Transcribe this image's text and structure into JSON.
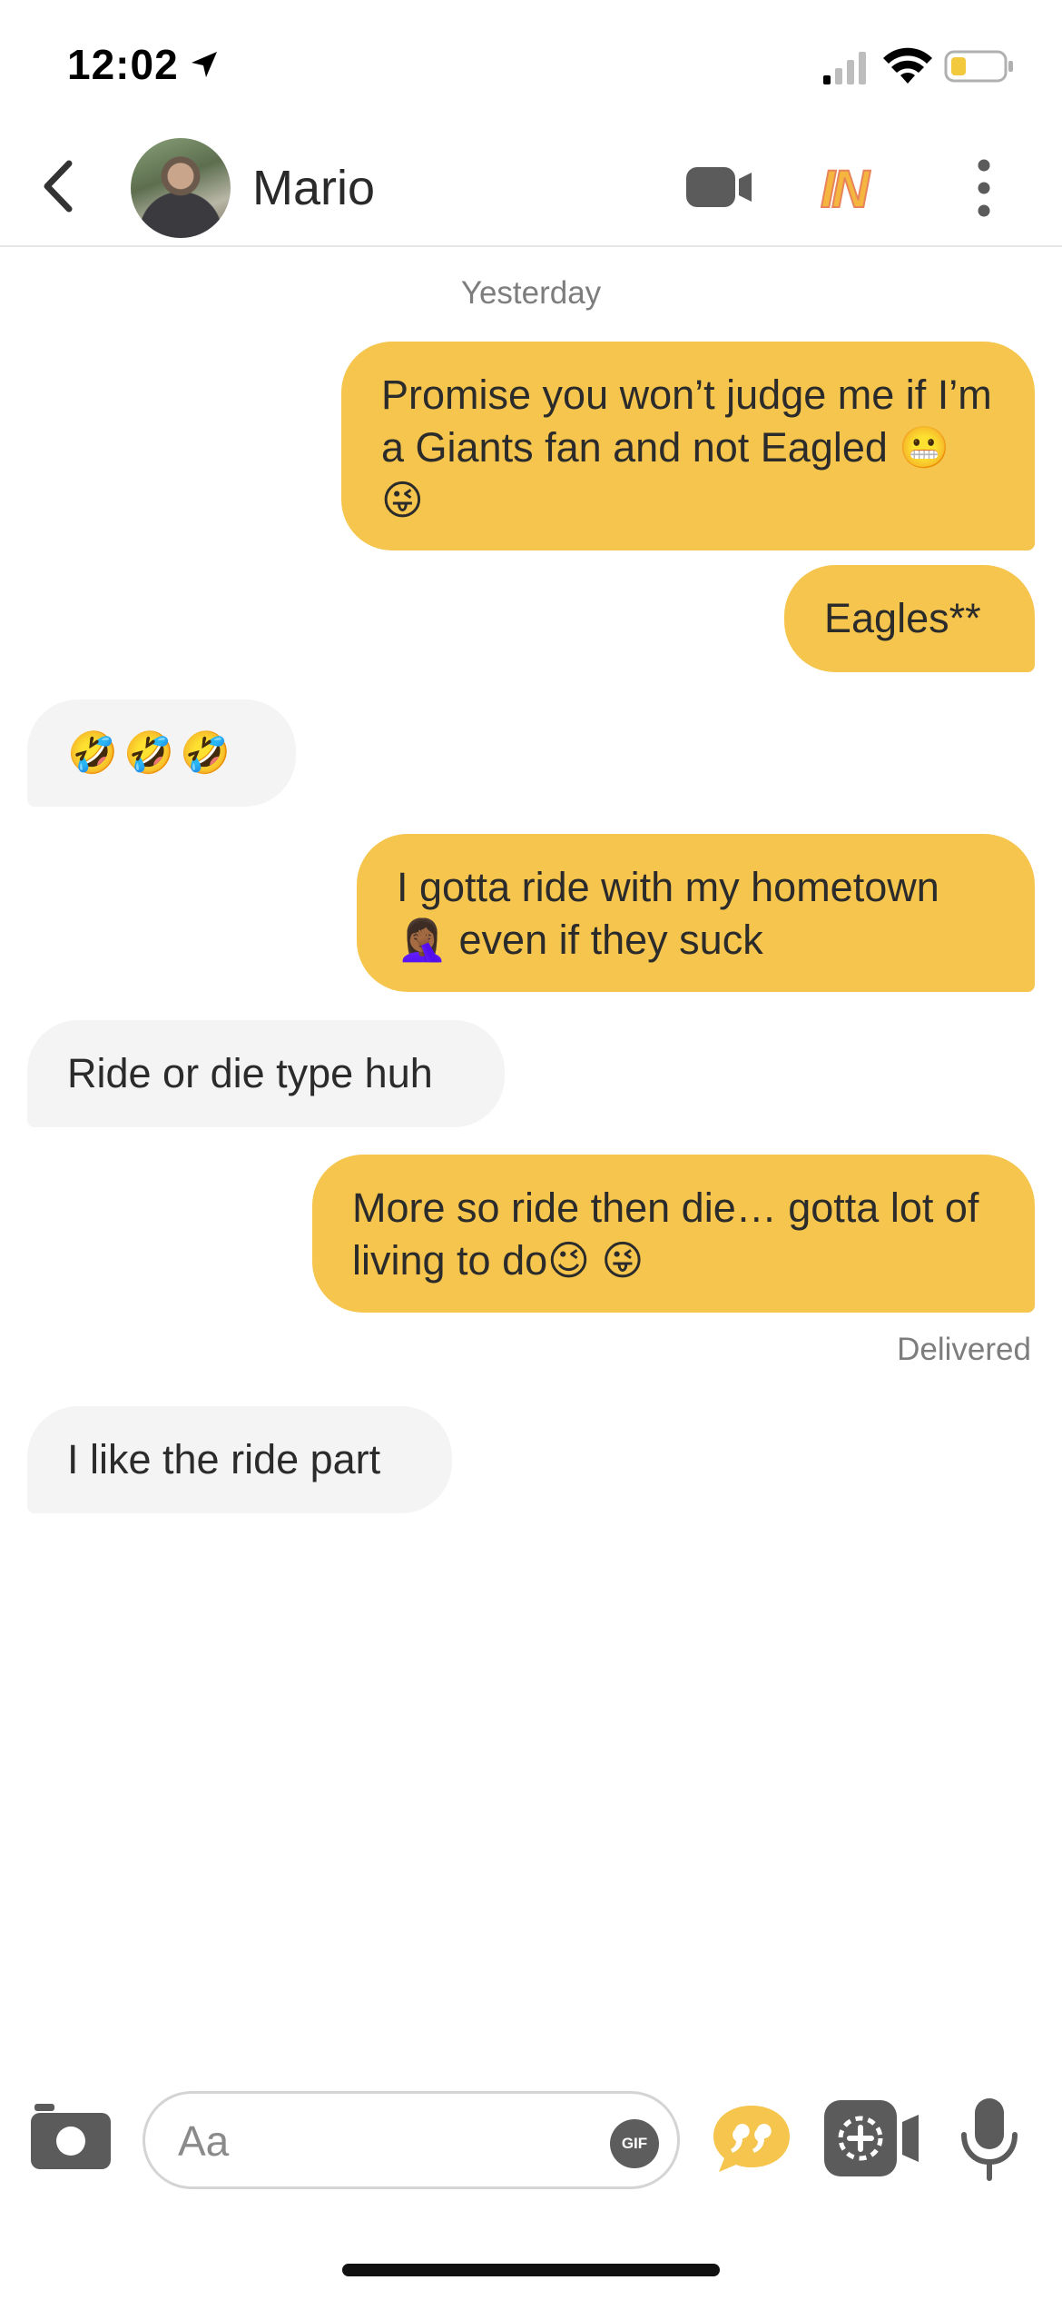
{
  "status_bar": {
    "time": "12:02"
  },
  "header": {
    "contact_name": "Mario",
    "icons": [
      "back-chevron-icon",
      "video-camera-icon",
      "in-boost-icon",
      "more-vertical-icon"
    ],
    "boost_label": "IN"
  },
  "chat": {
    "date_label": "Yesterday",
    "messages": [
      {
        "direction": "out",
        "text": "Promise you won’t judge me if I’m a Giants fan and not Eagled 😬 😜"
      },
      {
        "direction": "out",
        "text": "Eagles**"
      },
      {
        "direction": "in",
        "text": "🤣🤣🤣"
      },
      {
        "direction": "out",
        "text": "I gotta ride with my hometown 🤦🏾‍♀️ even if they suck"
      },
      {
        "direction": "in",
        "text": "Ride or die type huh"
      },
      {
        "direction": "out",
        "text": "More so ride then die… gotta lot of living to do😉 😜"
      },
      {
        "direction": "in",
        "text": "I like the ride part"
      }
    ],
    "delivered_label": "Delivered"
  },
  "composer": {
    "placeholder": "Aa",
    "gif_label": "GIF",
    "icons": [
      "camera-icon",
      "gif-icon",
      "quote-icon",
      "add-media-icon",
      "microphone-icon"
    ]
  },
  "colors": {
    "accent": "#f5c54d",
    "incoming_bubble": "#f4f4f4",
    "muted_text": "#7d7d7d"
  }
}
